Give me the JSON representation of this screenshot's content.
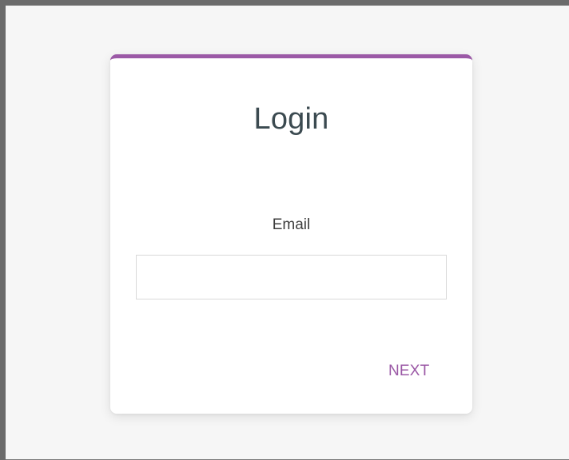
{
  "login": {
    "title": "Login",
    "email_label": "Email",
    "email_value": "",
    "email_placeholder": "",
    "next_label": "NEXT"
  },
  "colors": {
    "accent": "#9b59a6",
    "title": "#3b4a50",
    "page_background": "#f6f6f6",
    "card_background": "#ffffff",
    "outer_frame": "#6b6b6b"
  }
}
